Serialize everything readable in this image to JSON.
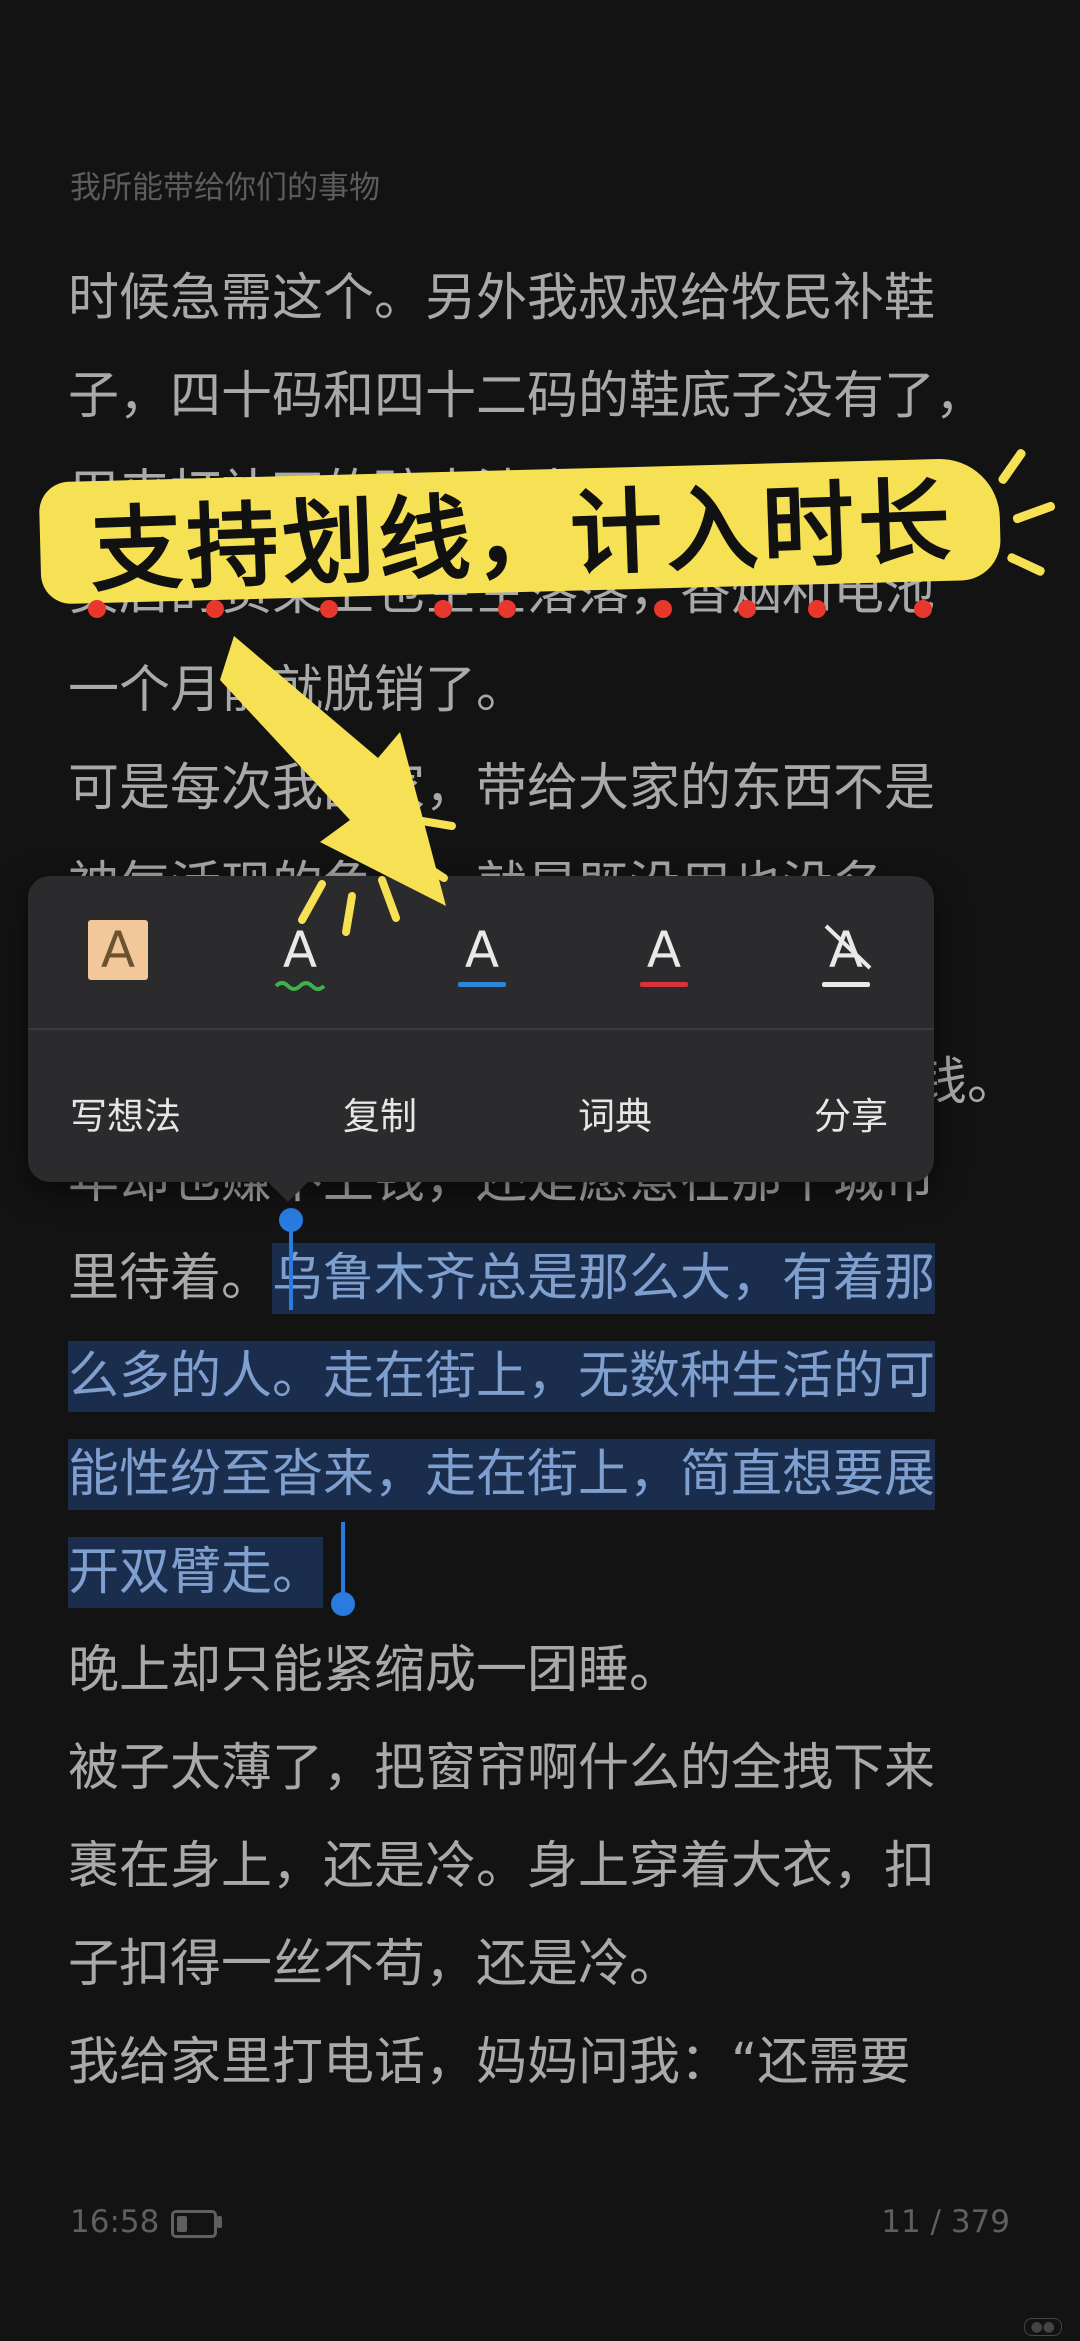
{
  "book": {
    "title": "我所能带给你们的事物"
  },
  "lines": [
    "时候急需这个。另外我叔叔给牧民补鞋",
    "子，四十码和四十二码的鞋底子没有了，",
    "用来打补丁的碎皮渣也不多了。我家小",
    "卖店的货架上也空空落落，香烟和电池",
    "一个月前就脱销了。",
    "可是每次我回家，带给大家的东西不是",
    "神气活现的龟子，就是既没用也没名",
    "",
    "钱。",
    "年却也赚不上钱，还是愿意在那个城市",
    "里待着。"
  ],
  "highlight": [
    "乌鲁木齐总是那么大，有着那",
    "么多的人。走在街上，无数种生活的可",
    "能性纷至沓来，走在街上，简直想要展",
    "开双臂走。"
  ],
  "lines_after": [
    "晚上却只能紧缩成一团睡。",
    "被子太薄了，把窗帘啊什么的全拽下来",
    "裹在身上，还是冷。身上穿着大衣，扣",
    "子扣得一丝不苟，还是冷。",
    "我给家里打电话，妈妈问我：“还需要"
  ],
  "popup": {
    "styles": [
      {
        "icon": "highlight-fill-icon",
        "glyph": "A"
      },
      {
        "icon": "wavy-underline-icon",
        "glyph": "A",
        "color": "#3db24a"
      },
      {
        "icon": "blue-underline-icon",
        "glyph": "A",
        "color": "#2f86d8"
      },
      {
        "icon": "red-underline-icon",
        "glyph": "A",
        "color": "#d8323a"
      },
      {
        "icon": "erase-style-icon",
        "glyph": "A"
      }
    ],
    "actions": {
      "note": "写想法",
      "copy": "复制",
      "dictionary": "词典",
      "share": "分享"
    }
  },
  "annotation": {
    "banner": "支持划线，计入时长"
  },
  "status": {
    "time": "16:58",
    "page": "11 / 379"
  },
  "colors": {
    "background": "#131313",
    "highlight": "#1a2d4d",
    "cursor": "#2a7be0",
    "banner": "#f6e154"
  }
}
